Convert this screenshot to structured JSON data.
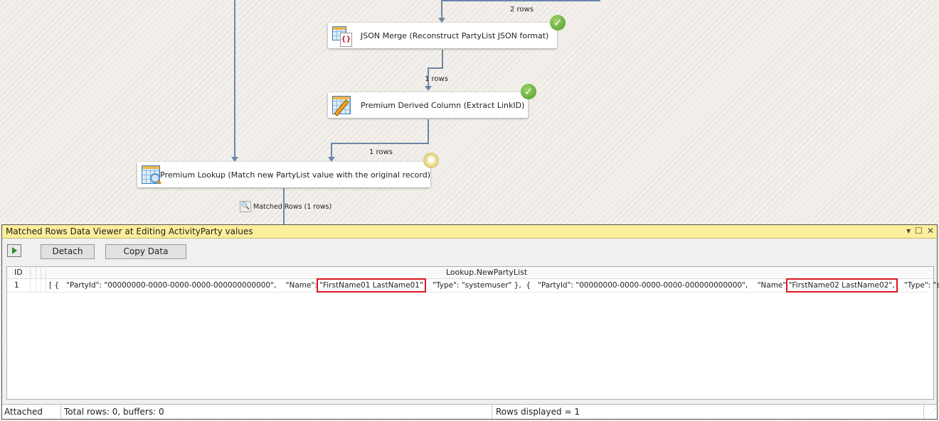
{
  "canvas": {
    "components": [
      {
        "name": "JSON Merge (Reconstruct PartyList JSON format)",
        "status": "success",
        "icon": "json-merge-icon"
      },
      {
        "name": "Premium Derived Column (Extract LinkID)",
        "status": "success",
        "icon": "derived-column-icon"
      },
      {
        "name": "Premium Lookup (Match new PartyList value with the original record)",
        "status": "running",
        "icon": "lookup-icon"
      }
    ],
    "paths": [
      {
        "label": "2 rows"
      },
      {
        "label": "1 rows"
      },
      {
        "label": "1 rows"
      }
    ],
    "data_viewer_label": "Matched Rows (1 rows)"
  },
  "viewer": {
    "title": "Matched Rows Data Viewer at Editing ActivityParty values",
    "controls": {
      "dropdown": "▾",
      "maximize": "☐",
      "close": "✕"
    },
    "toolbar": {
      "detach_label": "Detach",
      "copy_label": "Copy Data"
    },
    "grid": {
      "columns": [
        "ID",
        ".",
        "Lookup.NewPartyList"
      ],
      "rows": [
        {
          "id": "1",
          "segments": [
            "[ {   \"PartyId\": \"00000000-0000-0000-0000-000000000000\",    \"Name\": ",
            "\"FirstName01 LastName01\"",
            "    \"Type\": \"systemuser\" },  {   \"PartyId\": \"00000000-0000-0000-0000-000000000000\",    \"Name\" ",
            "\"FirstName02 LastName02\",",
            "    \"Type\": \"systemuser\"  }]"
          ]
        }
      ]
    },
    "status": {
      "state": "Attached",
      "totals": "Total rows: 0, buffers: 0",
      "displayed": "Rows displayed = 1"
    },
    "highlight_color": "#e0141e"
  }
}
